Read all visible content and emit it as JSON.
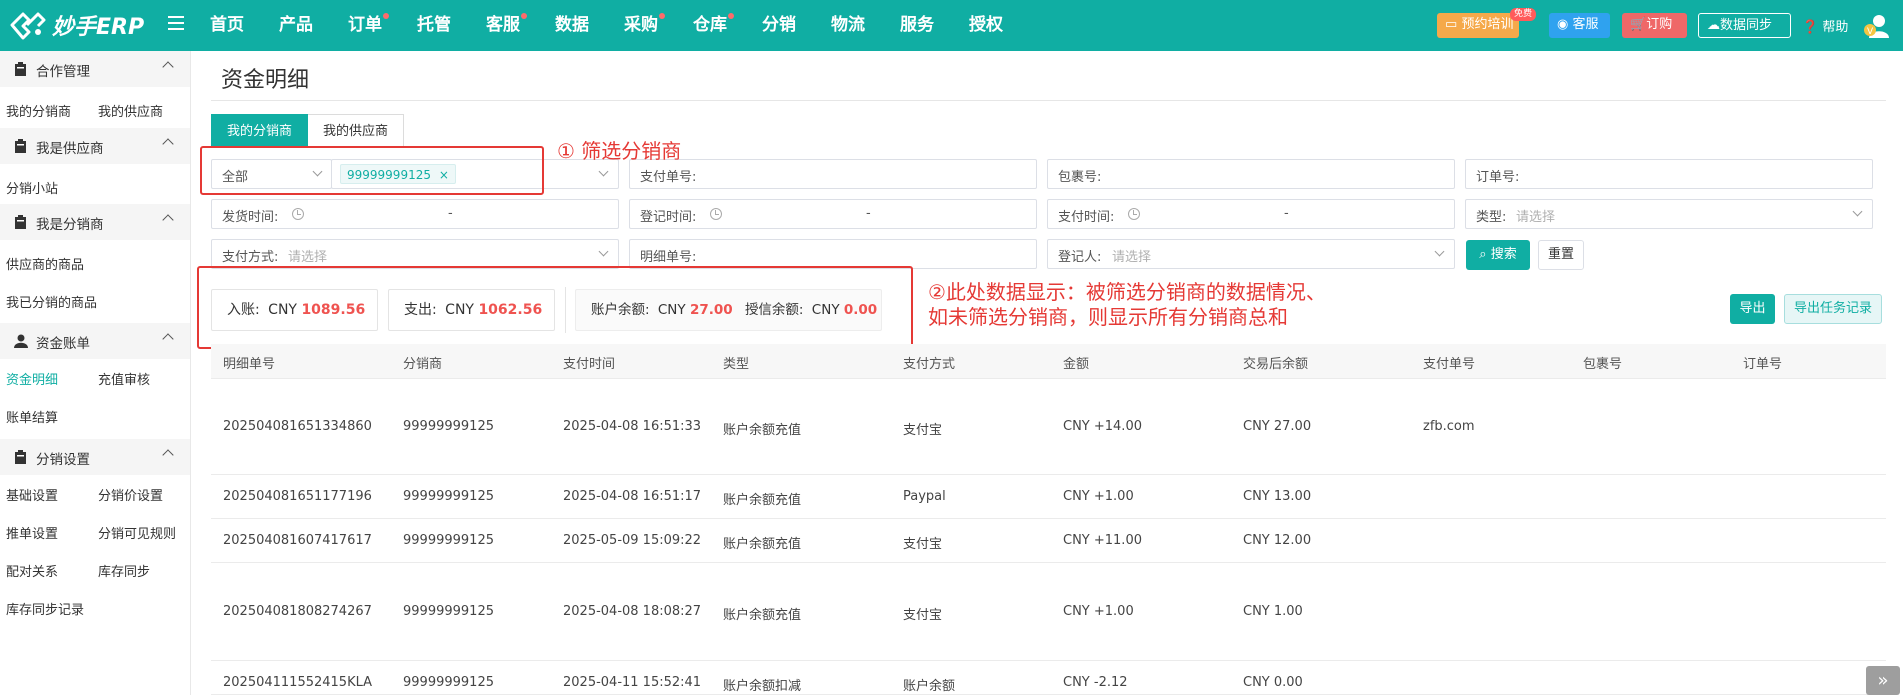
{
  "app": {
    "logo_text": "妙手ERP"
  },
  "nav": {
    "items": [
      {
        "label": "首页",
        "dot": false
      },
      {
        "label": "产品",
        "dot": false
      },
      {
        "label": "订单",
        "dot": true
      },
      {
        "label": "托管",
        "dot": false
      },
      {
        "label": "客服",
        "dot": true
      },
      {
        "label": "数据",
        "dot": false
      },
      {
        "label": "采购",
        "dot": true
      },
      {
        "label": "仓库",
        "dot": true
      },
      {
        "label": "分销",
        "dot": false
      },
      {
        "label": "物流",
        "dot": false
      },
      {
        "label": "服务",
        "dot": false
      },
      {
        "label": "授权",
        "dot": false
      }
    ]
  },
  "topbar": {
    "train_label": "预约培训",
    "free_badge": "免费",
    "service_label": "客服",
    "order_label": "订购",
    "sync_label": "数据同步",
    "help_label": "帮助"
  },
  "sidebar": {
    "groups": [
      {
        "title": "合作管理",
        "links": [
          "我的分销商",
          "我的供应商"
        ]
      },
      {
        "title": "我是供应商",
        "links": [
          "分销小站"
        ]
      },
      {
        "title": "我是分销商",
        "links": [
          "供应商的商品",
          "我已分销的商品"
        ]
      },
      {
        "title": "资金账单",
        "links": [
          "资金明细",
          "充值审核",
          "账单结算"
        ]
      },
      {
        "title": "分销设置",
        "links": [
          "基础设置",
          "分销价设置",
          "推单设置",
          "分销可见规则",
          "配对关系",
          "库存同步",
          "库存同步记录"
        ]
      }
    ]
  },
  "page": {
    "title": "资金明细",
    "tabs": [
      "我的分销商",
      "我的供应商"
    ]
  },
  "filters": {
    "scope_select": "全部",
    "distributor_tag": "99999999125",
    "pay_no_label": "支付单号:",
    "package_no_label": "包裹号:",
    "order_no_label": "订单号:",
    "ship_time_label": "发货时间:",
    "register_time_label": "登记时间:",
    "pay_time_label": "支付时间:",
    "range_sep": "-",
    "type_label": "类型:",
    "type_placeholder": "请选择",
    "pay_method_label": "支付方式:",
    "pay_method_placeholder": "请选择",
    "detail_no_label": "明细单号:",
    "registrar_label": "登记人:",
    "registrar_placeholder": "请选择",
    "search_label": "搜索",
    "reset_label": "重置"
  },
  "annotations": {
    "one": "① 筛选分销商",
    "two_line1": "②此处数据显示：被筛选分销商的数据情况、",
    "two_line2": "如未筛选分销商，则显示所有分销商总和"
  },
  "stats": {
    "income_label": "入账:",
    "income_currency": "CNY",
    "income_value": "1089.56",
    "expense_label": "支出:",
    "expense_currency": "CNY",
    "expense_value": "1062.56",
    "balance_label": "账户余额:",
    "balance_currency": "CNY",
    "balance_value": "27.00",
    "credit_label": "授信余额:",
    "credit_currency": "CNY",
    "credit_value": "0.00"
  },
  "actions": {
    "export_label": "导出",
    "export_log_label": "导出任务记录"
  },
  "table": {
    "columns": [
      "明细单号",
      "分销商",
      "支付时间",
      "类型",
      "支付方式",
      "金额",
      "交易后余额",
      "支付单号",
      "包裹号",
      "订单号"
    ],
    "rows": [
      [
        "202504081651334860",
        "99999999125",
        "2025-04-08 16:51:33",
        "账户余额充值",
        "支付宝",
        "CNY +14.00",
        "CNY 27.00",
        "zfb.com",
        "",
        ""
      ],
      [
        "202504081651177196",
        "99999999125",
        "2025-04-08 16:51:17",
        "账户余额充值",
        "Paypal",
        "CNY +1.00",
        "CNY 13.00",
        "",
        "",
        ""
      ],
      [
        "202504081607417617",
        "99999999125",
        "2025-05-09 15:09:22",
        "账户余额充值",
        "支付宝",
        "CNY +11.00",
        "CNY 12.00",
        "",
        "",
        ""
      ],
      [
        "202504081808274267",
        "99999999125",
        "2025-04-08 18:08:27",
        "账户余额充值",
        "支付宝",
        "CNY +1.00",
        "CNY 1.00",
        "",
        "",
        ""
      ],
      [
        "202504111552415KLA",
        "99999999125",
        "2025-04-11 15:52:41",
        "账户余额扣减",
        "账户余额",
        "CNY -2.12",
        "CNY 0.00",
        "",
        "",
        ""
      ]
    ]
  }
}
